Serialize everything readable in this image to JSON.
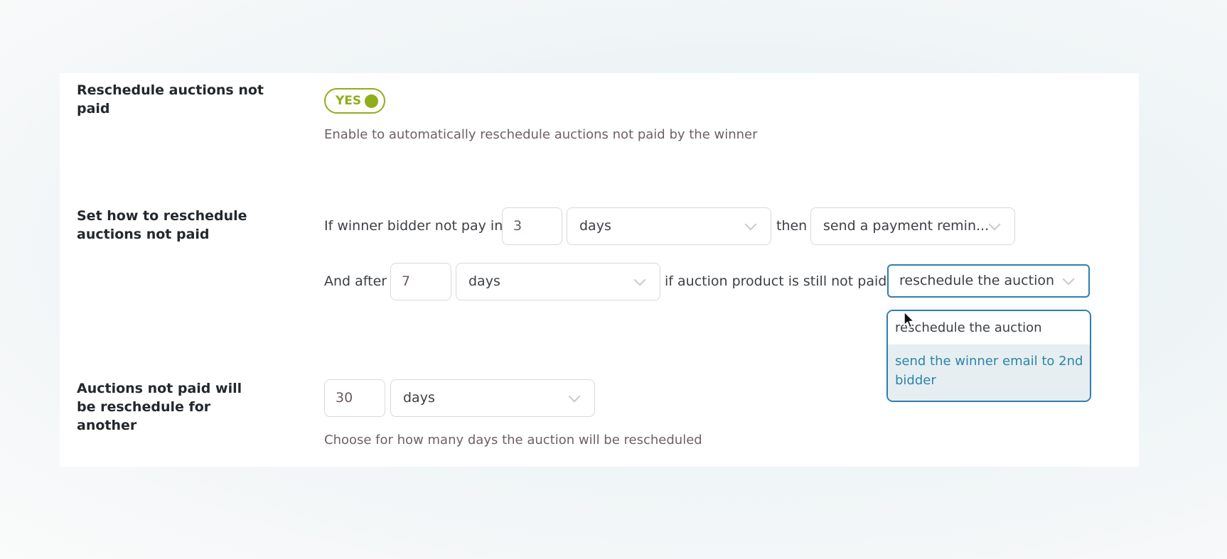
{
  "settings": {
    "reschedule_enabled": {
      "label": "Reschedule auctions not paid",
      "toggle_label": "YES",
      "toggle_on": true,
      "help": "Enable to automatically reschedule auctions not paid by the winner"
    },
    "reschedule_how": {
      "label": "Set how to reschedule auctions not paid",
      "line1": {
        "prefix": "If winner bidder not pay in",
        "amount": "3",
        "unit": "days",
        "middle": "then",
        "action": "send a payment remin..."
      },
      "line2": {
        "prefix": "And after",
        "amount": "7",
        "unit": "days",
        "middle": "if auction product is still not paid",
        "action": "reschedule the auction",
        "dropdown_open": true,
        "options": [
          "reschedule the auction",
          "send the winner email to 2nd bidder"
        ],
        "hovered_option": "send the winner email to 2nd bidder"
      }
    },
    "reschedule_duration": {
      "label": "Auctions not paid will be reschedule for another",
      "amount": "30",
      "unit": "days",
      "help": "Choose for how many days the auction will be rescheduled"
    }
  },
  "colors": {
    "toggle_accent": "#8fae1b",
    "focus_border": "#2c7fb5",
    "hover_option_text": "#2a86a6",
    "hover_option_bg": "#e6eef1"
  }
}
